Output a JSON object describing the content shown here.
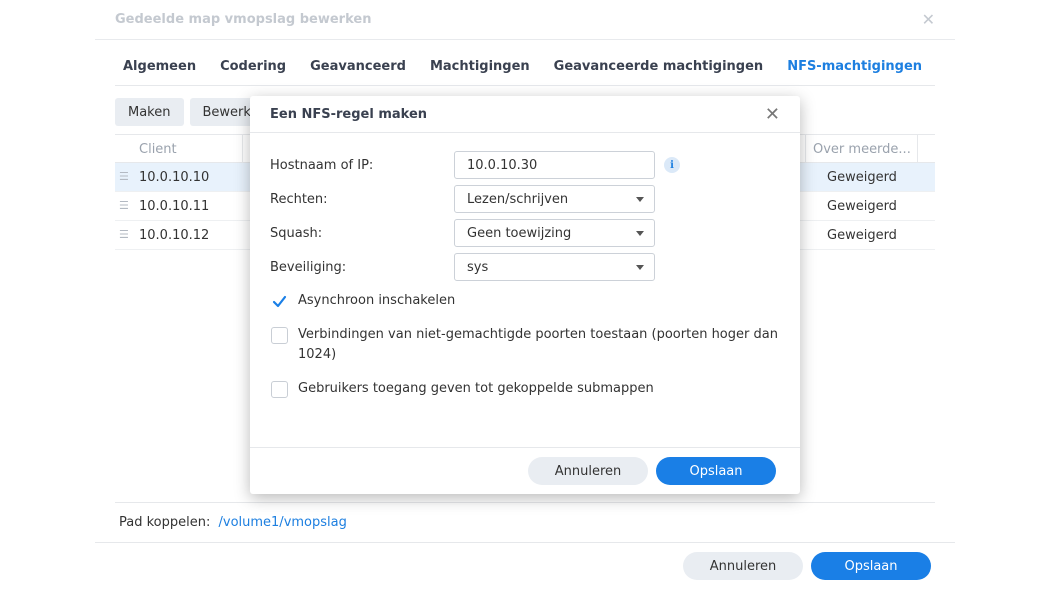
{
  "background_dialog": {
    "title": "Gedeelde map vmopslag bewerken",
    "close_icon": "close-icon",
    "tabs": [
      {
        "label": "Algemeen"
      },
      {
        "label": "Codering"
      },
      {
        "label": "Geavanceerd"
      },
      {
        "label": "Machtigingen"
      },
      {
        "label": "Geavanceerde machtigingen"
      },
      {
        "label": "NFS-machtigingen",
        "active": true
      }
    ],
    "toolbar": {
      "create_label": "Maken",
      "edit_label": "Bewerken"
    },
    "table": {
      "headers": {
        "client": "Client",
        "over": "Over meerde..."
      },
      "rows": [
        {
          "client": "10.0.10.10",
          "over": "Geweigerd",
          "selected": true
        },
        {
          "client": "10.0.10.11",
          "over": "Geweigerd"
        },
        {
          "client": "10.0.10.12",
          "over": "Geweigerd"
        }
      ]
    },
    "mount_path": {
      "label": "Pad koppelen:",
      "value": "/volume1/vmopslag"
    },
    "cancel_label": "Annuleren",
    "save_label": "Opslaan"
  },
  "modal": {
    "title": "Een NFS-regel maken",
    "fields": {
      "hostname": {
        "label": "Hostnaam of IP:",
        "value": "10.0.10.30",
        "info_icon": "info-icon"
      },
      "rights": {
        "label": "Rechten:",
        "value": "Lezen/schrijven"
      },
      "squash": {
        "label": "Squash:",
        "value": "Geen toewijzing"
      },
      "security": {
        "label": "Beveiliging:",
        "value": "sys"
      }
    },
    "checkboxes": {
      "async": {
        "label": "Asynchroon inschakelen",
        "checked": true
      },
      "unprivileged_ports": {
        "label": "Verbindingen van niet-gemachtigde poorten toestaan (poorten hoger dan 1024)",
        "checked": false
      },
      "submounts": {
        "label": "Gebruikers toegang geven tot gekoppelde submappen",
        "checked": false
      }
    },
    "cancel_label": "Annuleren",
    "save_label": "Opslaan"
  },
  "colors": {
    "accent": "#1a7fe6",
    "active_tab": "#1d7fe0",
    "selected_row": "#e8f2fc"
  }
}
